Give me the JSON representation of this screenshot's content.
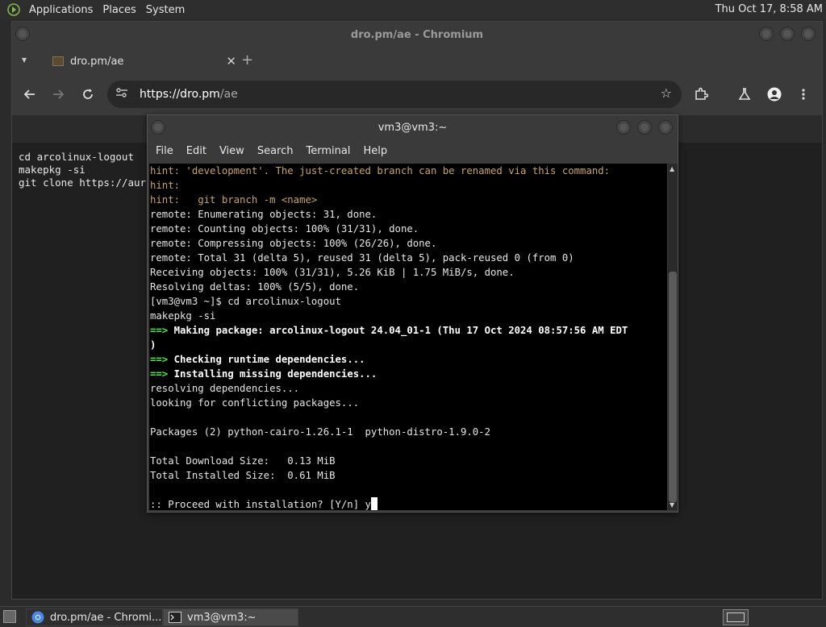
{
  "top_panel": {
    "menus": [
      "Applications",
      "Places",
      "System"
    ],
    "clock": "Thu Oct 17,  8:58 AM"
  },
  "chromium": {
    "window_title": "dro.pm/ae - Chromium",
    "tab_title": "dro.pm/ae",
    "url_host": "https://dro.pm",
    "url_path": "/ae",
    "page_lines": [
      "cd arcolinux-logout",
      "makepkg -si",
      "",
      "git clone https://aur"
    ]
  },
  "terminal": {
    "window_title": "vm3@vm3:~",
    "menus": [
      "File",
      "Edit",
      "View",
      "Search",
      "Terminal",
      "Help"
    ],
    "lines": [
      {
        "t": "hint: 'development'. The just-created branch can be renamed via this command:",
        "k": "hint"
      },
      {
        "t": "hint:",
        "k": "hint"
      },
      {
        "t": "hint:   git branch -m <name>",
        "k": "hint"
      },
      {
        "t": "remote: Enumerating objects: 31, done.",
        "k": "plain"
      },
      {
        "t": "remote: Counting objects: 100% (31/31), done.",
        "k": "plain"
      },
      {
        "t": "remote: Compressing objects: 100% (26/26), done.",
        "k": "plain"
      },
      {
        "t": "remote: Total 31 (delta 5), reused 31 (delta 5), pack-reused 0 (from 0)",
        "k": "plain"
      },
      {
        "t": "Receiving objects: 100% (31/31), 5.26 KiB | 1.75 MiB/s, done.",
        "k": "plain"
      },
      {
        "t": "Resolving deltas: 100% (5/5), done.",
        "k": "plain"
      },
      {
        "t": "[vm3@vm3 ~]$ cd arcolinux-logout",
        "k": "plain"
      },
      {
        "t": "makepkg -si",
        "k": "plain"
      },
      {
        "t": "Making package: arcolinux-logout 24.04_01-1 (Thu 17 Oct 2024 08:57:56 AM EDT",
        "k": "arrow"
      },
      {
        "t": ")",
        "k": "bold"
      },
      {
        "t": "Checking runtime dependencies...",
        "k": "arrow"
      },
      {
        "t": "Installing missing dependencies...",
        "k": "arrow"
      },
      {
        "t": "resolving dependencies...",
        "k": "plain"
      },
      {
        "t": "looking for conflicting packages...",
        "k": "plain"
      },
      {
        "t": "",
        "k": "plain"
      },
      {
        "t": "Packages (2) python-cairo-1.26.1-1  python-distro-1.9.0-2",
        "k": "plain"
      },
      {
        "t": "",
        "k": "plain"
      },
      {
        "t": "Total Download Size:   0.13 MiB",
        "k": "plain"
      },
      {
        "t": "Total Installed Size:  0.61 MiB",
        "k": "plain"
      },
      {
        "t": "",
        "k": "plain"
      },
      {
        "t": ":: Proceed with installation? [Y/n] y",
        "k": "prompt"
      }
    ],
    "arrow_glyph": "==>"
  },
  "taskbar": {
    "items": [
      "dro.pm/ae - Chromi...",
      "vm3@vm3:~"
    ]
  }
}
